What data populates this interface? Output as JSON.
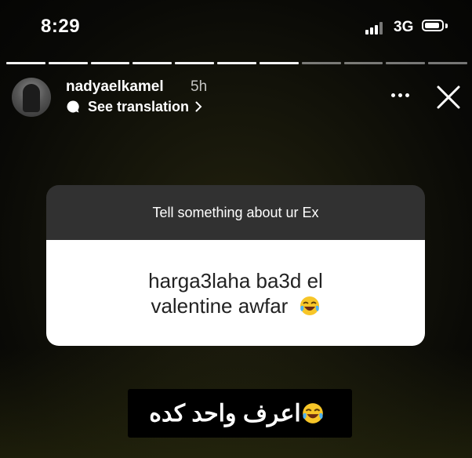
{
  "status_bar": {
    "time": "8:29",
    "network": "3G"
  },
  "story": {
    "progress_segments_done": 7,
    "progress_segments_total": 11,
    "username": "nadyaelkamel",
    "time_ago": "5h",
    "see_translation": "See translation",
    "question_title": "Tell something about ur Ex",
    "answer_line1": "harga3laha ba3d el",
    "answer_line2": "valentine awfar",
    "caption": "اعرف واحد كده"
  },
  "icons": {
    "more": "more-horizontal-icon",
    "close": "close-icon",
    "translate": "chat-bubble-icon",
    "emoji": "face-with-tears-of-joy-emoji"
  },
  "colors": {
    "card_header": "#313131",
    "card_body": "#ffffff",
    "answer_text": "#222222"
  }
}
